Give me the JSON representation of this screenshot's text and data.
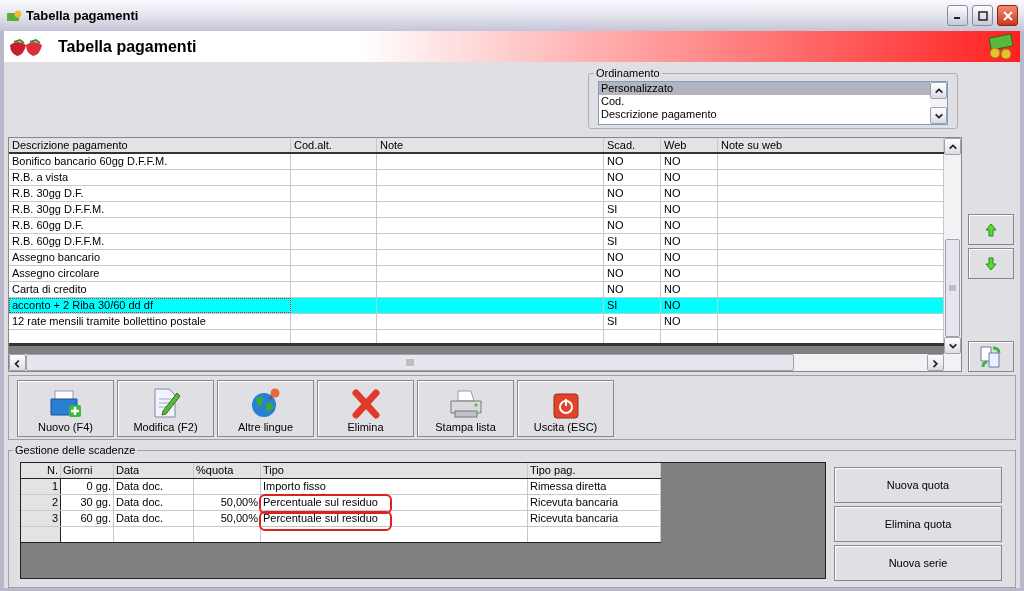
{
  "window": {
    "title": "Tabella pagamenti"
  },
  "header": {
    "title": "Tabella pagamenti"
  },
  "ordering": {
    "label": "Ordinamento",
    "items": [
      {
        "label": "Personalizzato",
        "selected": true
      },
      {
        "label": "Cod.",
        "selected": false
      },
      {
        "label": "Descrizione pagamento",
        "selected": false
      }
    ]
  },
  "table": {
    "columns": [
      "Descrizione pagamento",
      "Cod.alt.",
      "Note",
      "Scad.",
      "Web",
      "Note su web"
    ],
    "rows": [
      {
        "cells": [
          "Bonifico bancario 60gg D.F.F.M.",
          "",
          "",
          "NO",
          "NO",
          ""
        ],
        "selected": false
      },
      {
        "cells": [
          "R.B. a vista",
          "",
          "",
          "NO",
          "NO",
          ""
        ],
        "selected": false
      },
      {
        "cells": [
          "R.B. 30gg D.F.",
          "",
          "",
          "NO",
          "NO",
          ""
        ],
        "selected": false
      },
      {
        "cells": [
          "R.B. 30gg D.F.F.M.",
          "",
          "",
          "SI",
          "NO",
          ""
        ],
        "selected": false
      },
      {
        "cells": [
          "R.B. 60gg D.F.",
          "",
          "",
          "NO",
          "NO",
          ""
        ],
        "selected": false
      },
      {
        "cells": [
          "R.B. 60gg D.F.F.M.",
          "",
          "",
          "SI",
          "NO",
          ""
        ],
        "selected": false
      },
      {
        "cells": [
          "Assegno bancario",
          "",
          "",
          "NO",
          "NO",
          ""
        ],
        "selected": false
      },
      {
        "cells": [
          "Assegno circolare",
          "",
          "",
          "NO",
          "NO",
          ""
        ],
        "selected": false
      },
      {
        "cells": [
          "Carta di credito",
          "",
          "",
          "NO",
          "NO",
          ""
        ],
        "selected": false
      },
      {
        "cells": [
          "acconto + 2 Riba 30/60 dd df",
          "",
          "",
          "SI",
          "NO",
          ""
        ],
        "selected": true
      },
      {
        "cells": [
          "12 rate mensili tramite bollettino postale",
          "",
          "",
          "SI",
          "NO",
          ""
        ],
        "selected": false
      }
    ]
  },
  "toolbar": [
    {
      "label": "Nuovo (F4)",
      "kind": "new"
    },
    {
      "label": "Modifica (F2)",
      "kind": "edit"
    },
    {
      "label": "Altre lingue",
      "kind": "globe"
    },
    {
      "label": "Elimina",
      "kind": "delete"
    },
    {
      "label": "Stampa lista",
      "kind": "print"
    },
    {
      "label": "Uscita (ESC)",
      "kind": "exit"
    }
  ],
  "schedule": {
    "title": "Gestione delle scadenze",
    "columns": [
      "N.",
      "Giorni",
      "Data",
      "%quota",
      "Tipo",
      "Tipo pag."
    ],
    "rows": [
      {
        "cells": [
          "1",
          "0 gg.",
          "Data doc.",
          "",
          "Importo fisso",
          "Rimessa diretta"
        ],
        "highlighted": false
      },
      {
        "cells": [
          "2",
          "30 gg.",
          "Data doc.",
          "50,00%",
          "Percentuale sul residuo",
          "Ricevuta bancaria"
        ],
        "highlighted": true
      },
      {
        "cells": [
          "3",
          "60 gg.",
          "Data doc.",
          "50,00%",
          "Percentuale sul residuo",
          "Ricevuta bancaria"
        ],
        "highlighted": true
      }
    ]
  },
  "schedule_buttons": [
    "Nuova quota",
    "Elimina quota",
    "Nuova serie"
  ]
}
